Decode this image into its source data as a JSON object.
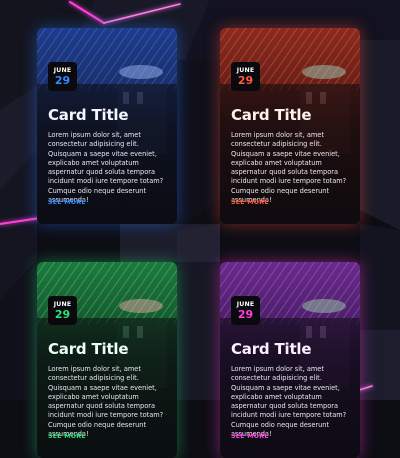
{
  "cards": [
    {
      "month": "JUNE",
      "day": "29",
      "title": "Card Title",
      "description": "Lorem ipsum dolor sit, amet consectetur adipisicing elit. Quisquam a saepe vitae eveniet, explicabo amet voluptatum aspernatur quod soluta tempora incidunt modi iure tempore totam? Cumque odio neque deserunt assumenda!",
      "link": "SEE MORE",
      "accent": "#2f8bff",
      "tint": "#1a3aa8"
    },
    {
      "month": "JUNE",
      "day": "29",
      "title": "Card Title",
      "description": "Lorem ipsum dolor sit, amet consectetur adipisicing elit. Quisquam a saepe vitae eveniet, explicabo amet voluptatum aspernatur quod soluta tempora incidunt modi iure tempore totam? Cumque odio neque deserunt assumenda!",
      "link": "SEE MORE",
      "accent": "#ff5a3c",
      "tint": "#a8281a"
    },
    {
      "month": "JUNE",
      "day": "29",
      "title": "Card Title",
      "description": "Lorem ipsum dolor sit, amet consectetur adipisicing elit. Quisquam a saepe vitae eveniet, explicabo amet voluptatum aspernatur quod soluta tempora incidunt modi iure tempore totam? Cumque odio neque deserunt assumenda!",
      "link": "SEE MORE",
      "accent": "#2ee07a",
      "tint": "#1a8a3e"
    },
    {
      "month": "JUNE",
      "day": "29",
      "title": "Card Title",
      "description": "Lorem ipsum dolor sit, amet consectetur adipisicing elit. Quisquam a saepe vitae eveniet, explicabo amet voluptatum aspernatur quod soluta tempora incidunt modi iure tempore totam? Cumque odio neque deserunt assumenda!",
      "link": "SEE MORE",
      "accent": "#ff3fe0",
      "tint": "#8a2aa8"
    }
  ],
  "background": {
    "base": "#0d0d14",
    "neon": "#ff3fd8"
  }
}
